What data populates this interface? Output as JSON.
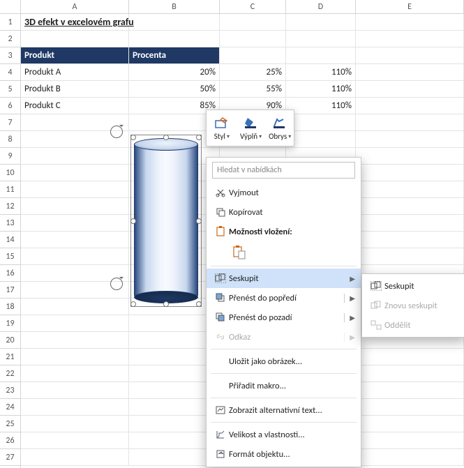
{
  "columns": [
    "A",
    "B",
    "C",
    "D",
    "E"
  ],
  "rows": [
    "1",
    "2",
    "3",
    "4",
    "5",
    "6",
    "7",
    "8",
    "9",
    "10",
    "11",
    "12",
    "13",
    "14",
    "15",
    "16",
    "17",
    "18",
    "19",
    "20",
    "21",
    "22",
    "23",
    "24",
    "25",
    "26",
    "27"
  ],
  "title": "3D efekt v excelovém grafu",
  "headers": {
    "produkt": "Produkt",
    "procenta": "Procenta"
  },
  "data": [
    {
      "produkt": "Produkt A",
      "b": "20%",
      "c": "25%",
      "d": "110%"
    },
    {
      "produkt": "Produkt B",
      "b": "50%",
      "c": "55%",
      "d": "110%"
    },
    {
      "produkt": "Produkt C",
      "b": "85%",
      "c": "90%",
      "d": "110%"
    }
  ],
  "mini": {
    "styl": "Styl",
    "vypln": "Výplň",
    "obrys": "Obrys"
  },
  "menu": {
    "search_placeholder": "Hledat v nabídkách",
    "cut": "Vyjmout",
    "copy": "Kopírovat",
    "paste_options": "Možnosti vložení:",
    "group": "Seskupit",
    "bring_front": "Přenést do popředí",
    "send_back": "Přenést do pozadí",
    "link": "Odkaz",
    "save_as_picture": "Uložit jako obrázek...",
    "assign_macro": "Přiřadit makro...",
    "alt_text": "Zobrazit alternativní text...",
    "size_props": "Velikost a vlastnosti...",
    "format_object": "Formát objektu..."
  },
  "submenu": {
    "group": "Seskupit",
    "regroup": "Znovu seskupit",
    "ungroup": "Oddělit"
  }
}
